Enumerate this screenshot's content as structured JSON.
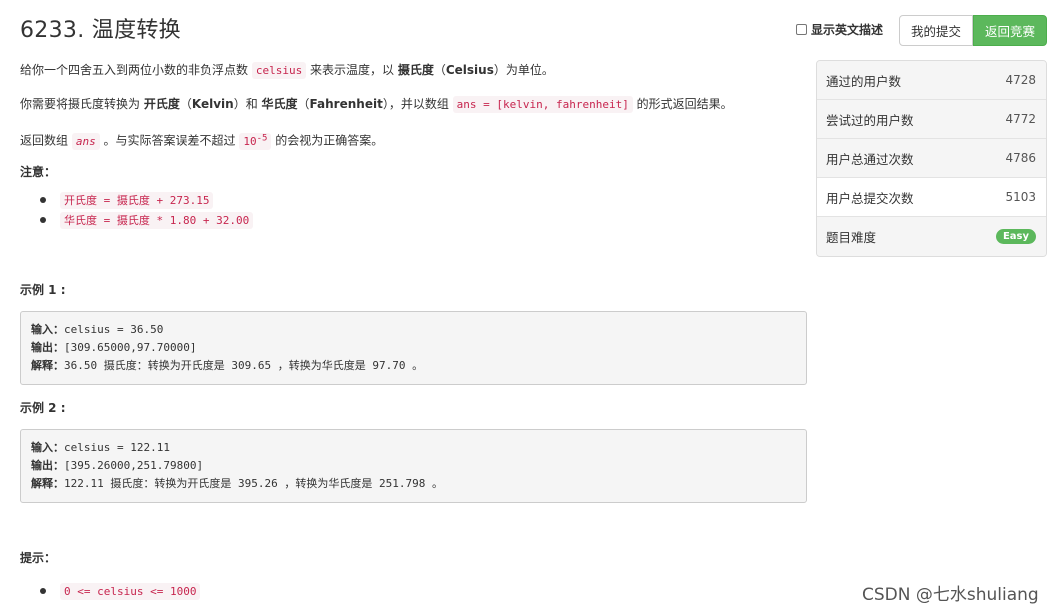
{
  "problem": {
    "title": "6233. 温度转换",
    "desc1": {
      "before": "给你一个四舍五入到两位小数的非负浮点数 ",
      "code": "celsius",
      "after1": " 来表示温度，以 ",
      "bold": "摄氏度",
      "paren": "（",
      "bold_en": "Celsius",
      "after2": "）为单位。"
    },
    "desc2": {
      "a": "你需要将摄氏度转换为 ",
      "b": "开氏度",
      "c": "（",
      "d": "Kelvin",
      "e": "）和 ",
      "f": "华氏度",
      "g": "（",
      "h": "Fahrenheit",
      "i": "），并以数组 ",
      "code": "ans = [kelvin, fahrenheit]",
      "j": " 的形式返回结果。"
    },
    "desc3": {
      "a": "返回数组 ",
      "code": "ans",
      "b": " 。与实际答案误差不超过 ",
      "code2": "10",
      "sup": "-5",
      "c": " 的会视为正确答案。"
    },
    "note_label": "注意：",
    "notes": [
      "开氏度 = 摄氏度 + 273.15",
      "华氏度 = 摄氏度 * 1.80 + 32.00"
    ],
    "examples": [
      {
        "label": "示例 1 :",
        "input_key": "输入：",
        "input": "celsius = 36.50",
        "output_key": "输出：",
        "output": "[309.65000,97.70000]",
        "explain_key": "解释：",
        "explain": "36.50 摄氏度：转换为开氏度是 309.65 ，转换为华氏度是 97.70 。"
      },
      {
        "label": "示例 2 :",
        "input_key": "输入：",
        "input": "celsius = 122.11",
        "output_key": "输出：",
        "output": "[395.26000,251.79800]",
        "explain_key": "解释：",
        "explain": "122.11 摄氏度：转换为开氏度是 395.26 ，转换为华氏度是 251.798 。"
      }
    ],
    "hint_label": "提示：",
    "hints": [
      "0 <= celsius <= 1000"
    ]
  },
  "toolbar": {
    "show_english": "显示英文描述",
    "my_submissions": "我的提交",
    "back_to_contest": "返回竞赛"
  },
  "stats": [
    {
      "label": "通过的用户数",
      "value": "4728"
    },
    {
      "label": "尝试过的用户数",
      "value": "4772"
    },
    {
      "label": "用户总通过次数",
      "value": "4786"
    },
    {
      "label": "用户总提交次数",
      "value": "5103"
    },
    {
      "label": "题目难度",
      "value": "Easy"
    }
  ],
  "colors": {
    "accent_green": "#5cb85c",
    "code_red": "#c7254e"
  },
  "watermark": "CSDN @七水shuliang"
}
